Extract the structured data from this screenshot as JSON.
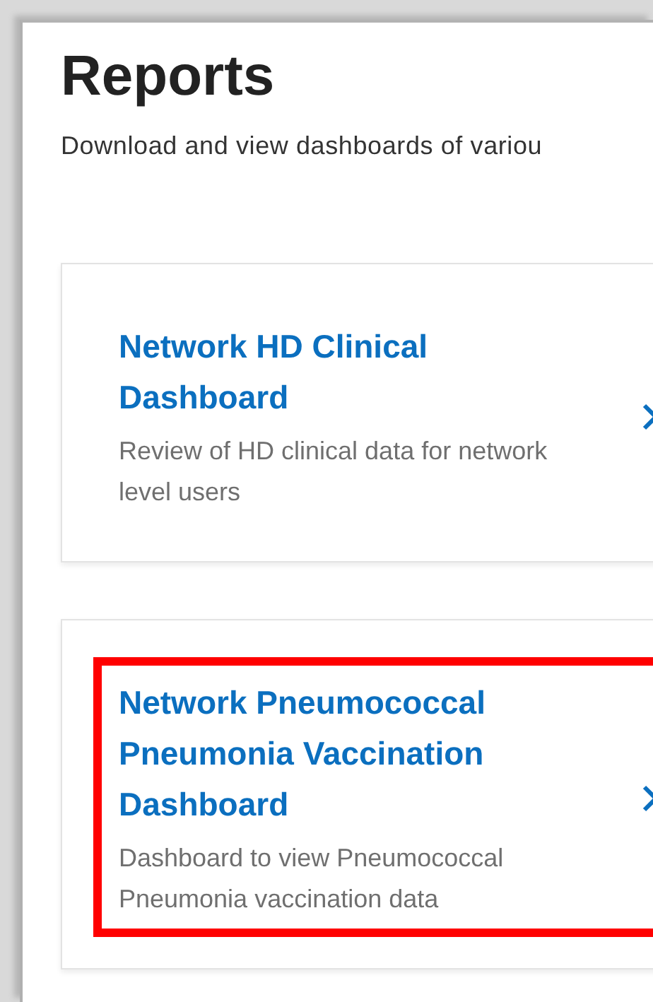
{
  "page": {
    "title": "Reports",
    "subtitle": "Download and view dashboards of variou"
  },
  "reports": [
    {
      "title": "Network HD Clinical Dashboard",
      "description": "Review of HD clinical data for network level users",
      "highlighted": false
    },
    {
      "title": "Network Pneumococcal Pneumonia Vaccination Dashboard",
      "description": "Dashboard to view Pneumococcal Pneumonia vaccination data",
      "highlighted": true
    }
  ]
}
